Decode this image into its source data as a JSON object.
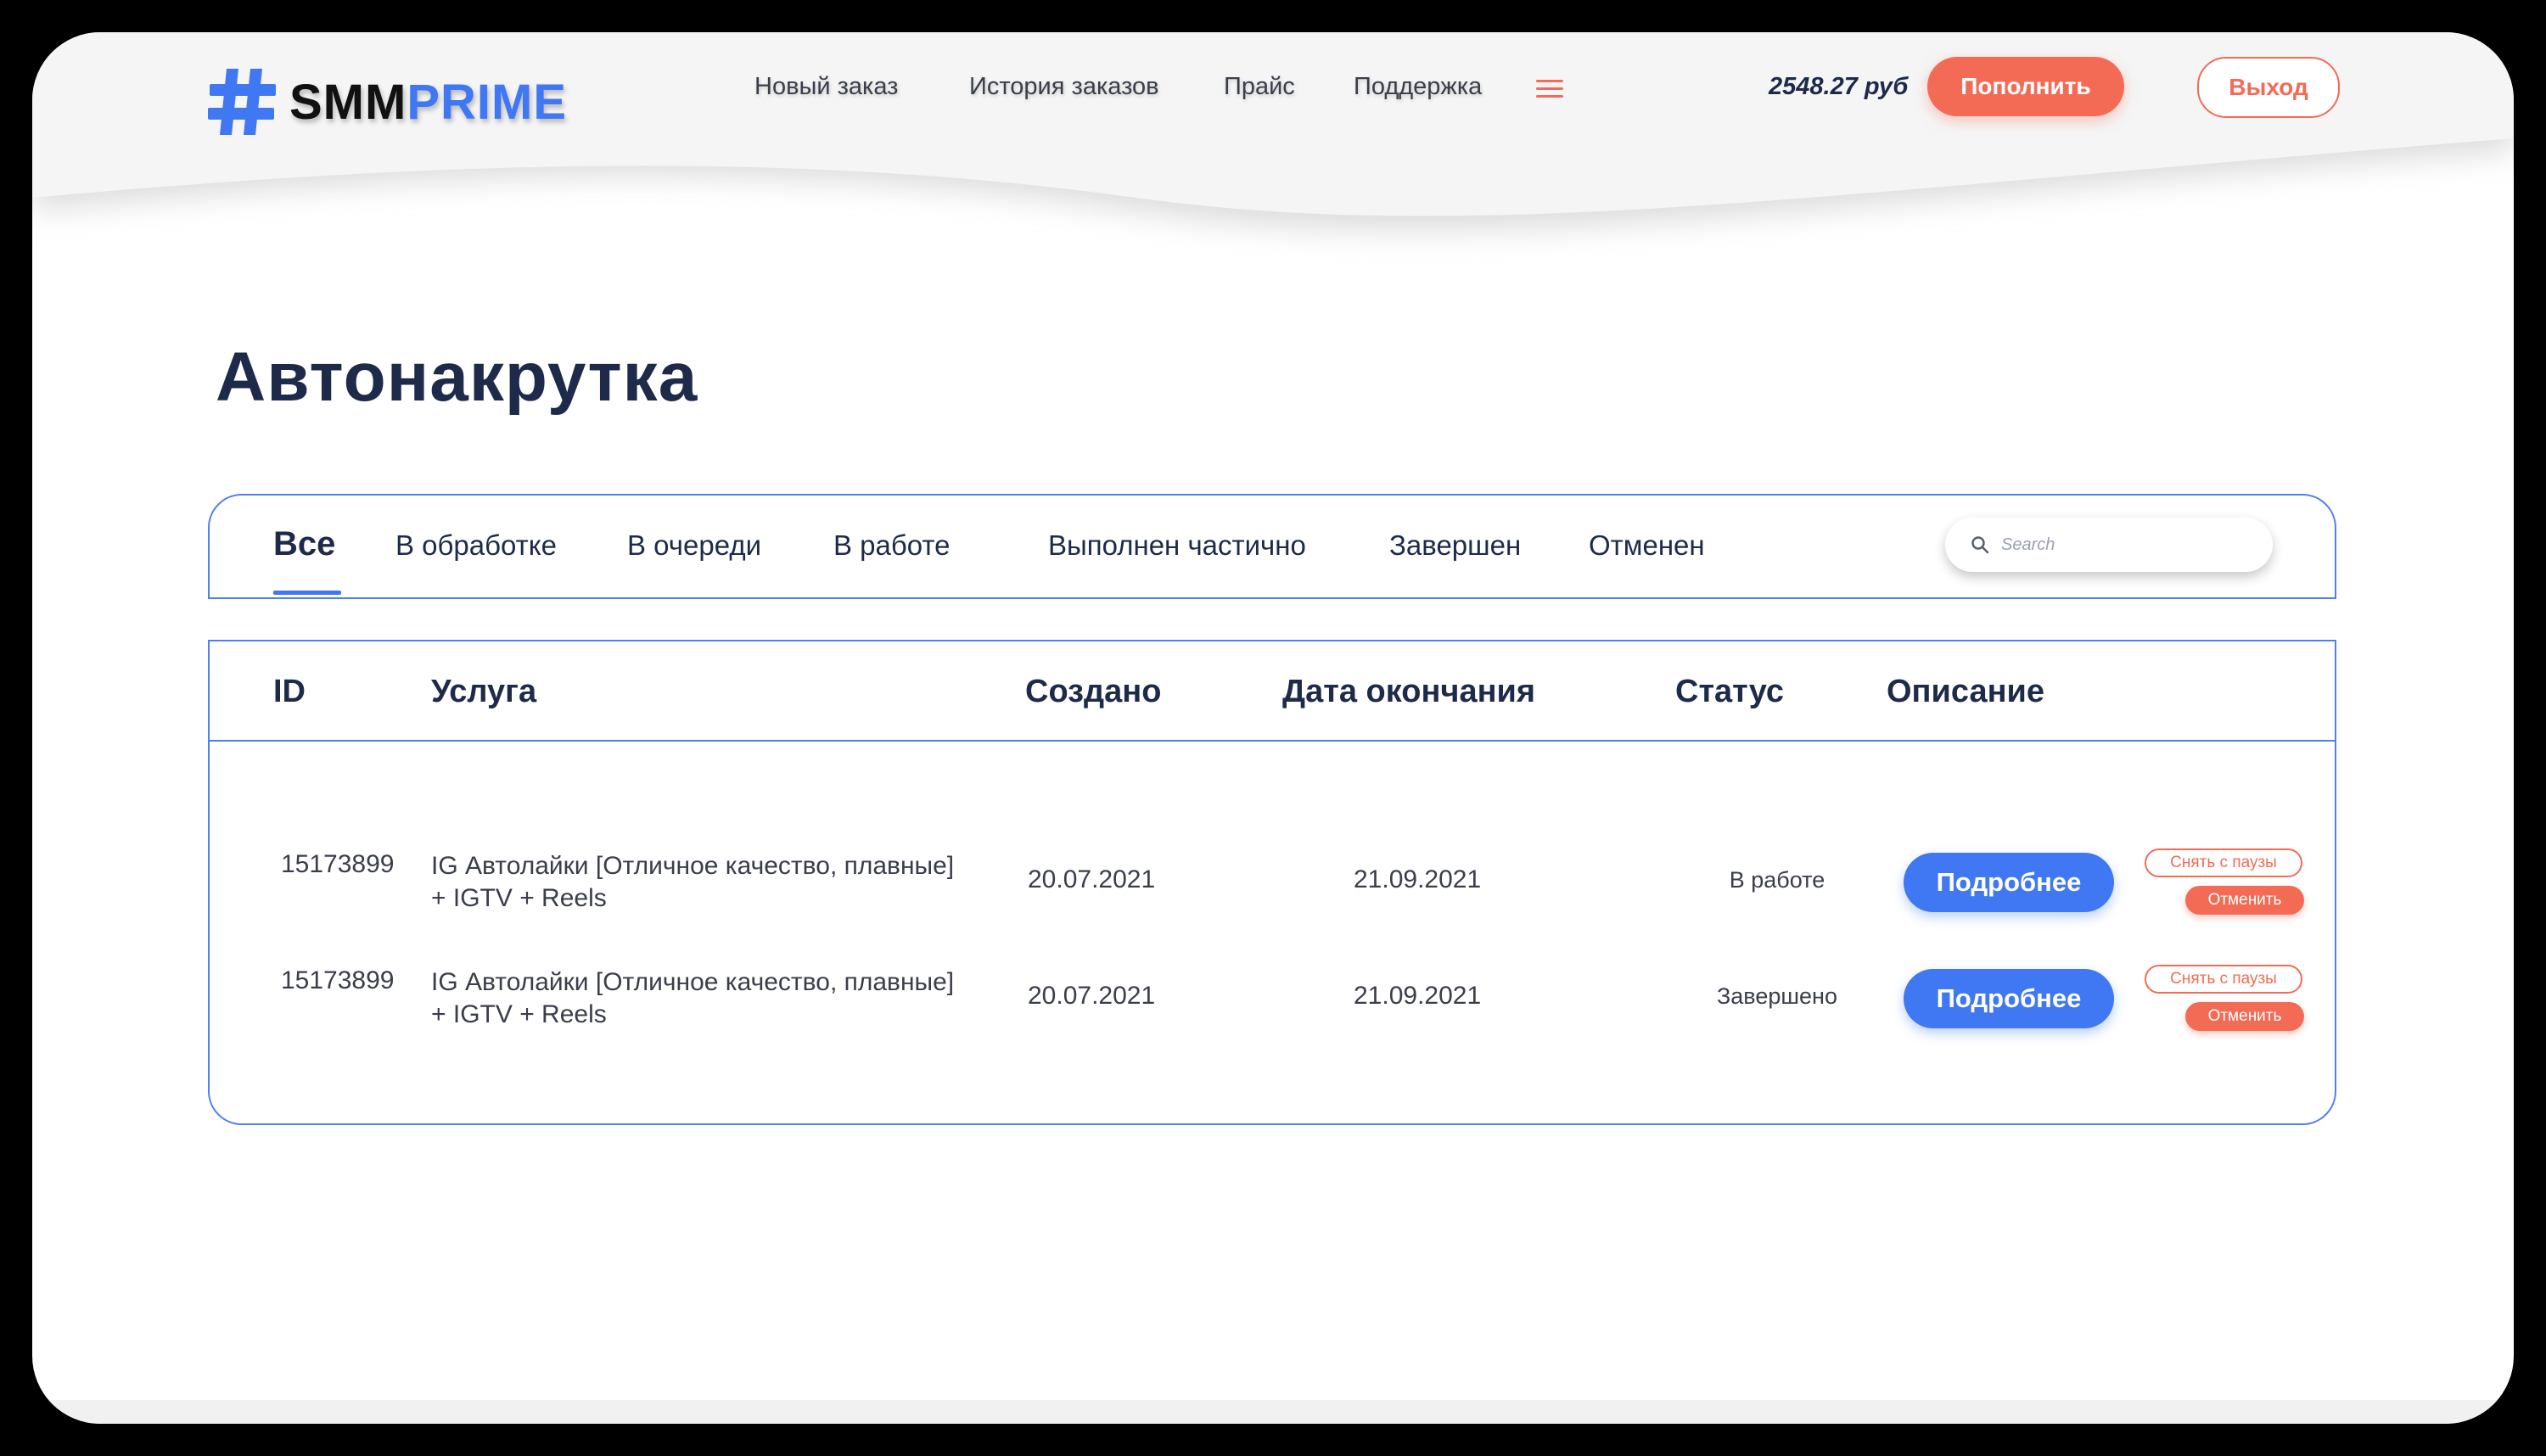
{
  "header": {
    "logo": {
      "part1": "SMM",
      "part2": "PRIME",
      "icon": "hashtag-logo-icon"
    },
    "nav": [
      {
        "label": "Новый заказ"
      },
      {
        "label": "История заказов"
      },
      {
        "label": "Прайс"
      },
      {
        "label": "Поддержка"
      }
    ],
    "menu_icon": "hamburger-menu-icon",
    "balance": "2548.27 руб",
    "topup_label": "Пополнить",
    "exit_label": "Выход"
  },
  "page": {
    "title": "Автонакрутка"
  },
  "tabs": [
    {
      "label": "Все",
      "active": true
    },
    {
      "label": "В обработке"
    },
    {
      "label": "В очереди"
    },
    {
      "label": "В работе"
    },
    {
      "label": "Выполнен частично"
    },
    {
      "label": "Завершен"
    },
    {
      "label": "Отменен"
    }
  ],
  "search": {
    "placeholder": "Search",
    "value": ""
  },
  "table": {
    "headers": {
      "id": "ID",
      "service": "Услуга",
      "created": "Создано",
      "end_date": "Дата окончания",
      "status": "Статус",
      "description": "Описание"
    },
    "rows": [
      {
        "id": "15173899",
        "service": "IG Автолайки [Отличное качество, плавные] + IGTV + Reels",
        "created": "20.07.2021",
        "end_date": "21.09.2021",
        "status": "В работе",
        "more_label": "Подробнее",
        "unpause_label": "Снять с паузы",
        "cancel_label": "Отменить"
      },
      {
        "id": "15173899",
        "service": "IG Автолайки [Отличное качество, плавные] + IGTV + Reels",
        "created": "20.07.2021",
        "end_date": "21.09.2021",
        "status": "Завершено",
        "more_label": "Подробнее",
        "unpause_label": "Снять с паузы",
        "cancel_label": "Отменить"
      }
    ]
  },
  "colors": {
    "accent_blue": "#3f78f2",
    "accent_coral": "#f46b55",
    "title_navy": "#1d2a4a"
  }
}
